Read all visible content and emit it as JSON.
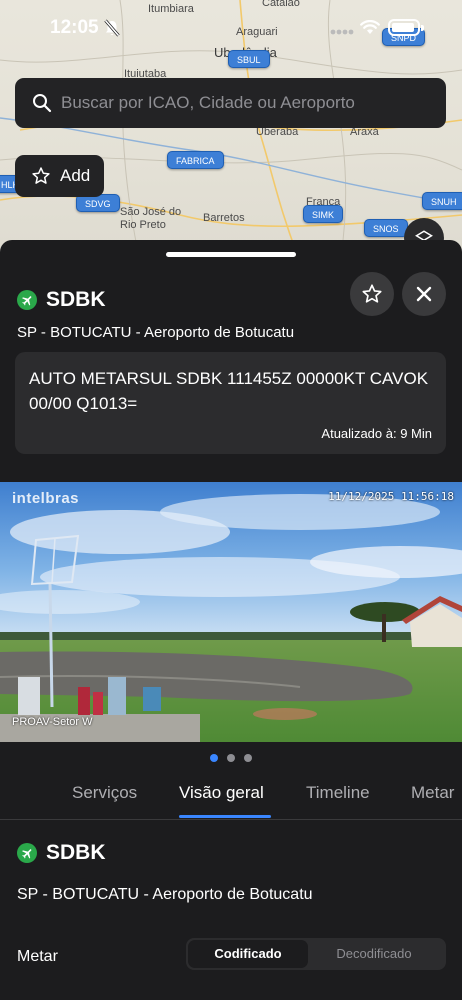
{
  "status_bar": {
    "time": "12:05"
  },
  "map": {
    "places": [
      {
        "label": "Itumbiara"
      },
      {
        "label": "Catalão"
      },
      {
        "label": "Araguari"
      },
      {
        "label": "Uberlândia"
      },
      {
        "label": "Ituiutaba"
      },
      {
        "label": "Uberaba"
      },
      {
        "label": "Araxá"
      },
      {
        "label": "São José do Rio Preto"
      },
      {
        "label": "Barretos"
      },
      {
        "label": "Franca"
      }
    ],
    "airport_chips": [
      "SNPD",
      "SBUL",
      "FABRICA",
      "SDVG",
      "SIMK",
      "SNOS",
      "SNUH",
      "HLH"
    ]
  },
  "search": {
    "placeholder": "Buscar por ICAO, Cidade ou Aeroporto"
  },
  "add_button": {
    "label": "Add"
  },
  "sheet": {
    "icao": "SDBK",
    "airport_name": "SP - BOTUCATU - Aeroporto de Botucatu",
    "metar_raw": "AUTO METARSUL SDBK 111455Z 00000KT CAVOK 00/00 Q1013=",
    "updated": "Atualizado à: 9 Min",
    "camera": {
      "brand": "intelbras",
      "timestamp": "11/12/2025 11:56:18",
      "label": "PROAV-Setor W"
    },
    "pager": {
      "count": 3,
      "active": 0
    },
    "tabs": [
      "Serviços",
      "Visão geral",
      "Timeline",
      "Metar"
    ],
    "active_tab": "Visão geral",
    "overview": {
      "icao": "SDBK",
      "airport_name": "SP - BOTUCATU - Aeroporto de Botucatu",
      "metar_label": "Metar",
      "segment": [
        "Codificado",
        "Decodificado"
      ]
    }
  },
  "colors": {
    "accent": "#3a86ff",
    "airport_green": "#2aa84a",
    "chip_blue": "#3d7fd6",
    "sheet_bg": "#1c1c1e",
    "card_bg": "#2c2c2e"
  }
}
